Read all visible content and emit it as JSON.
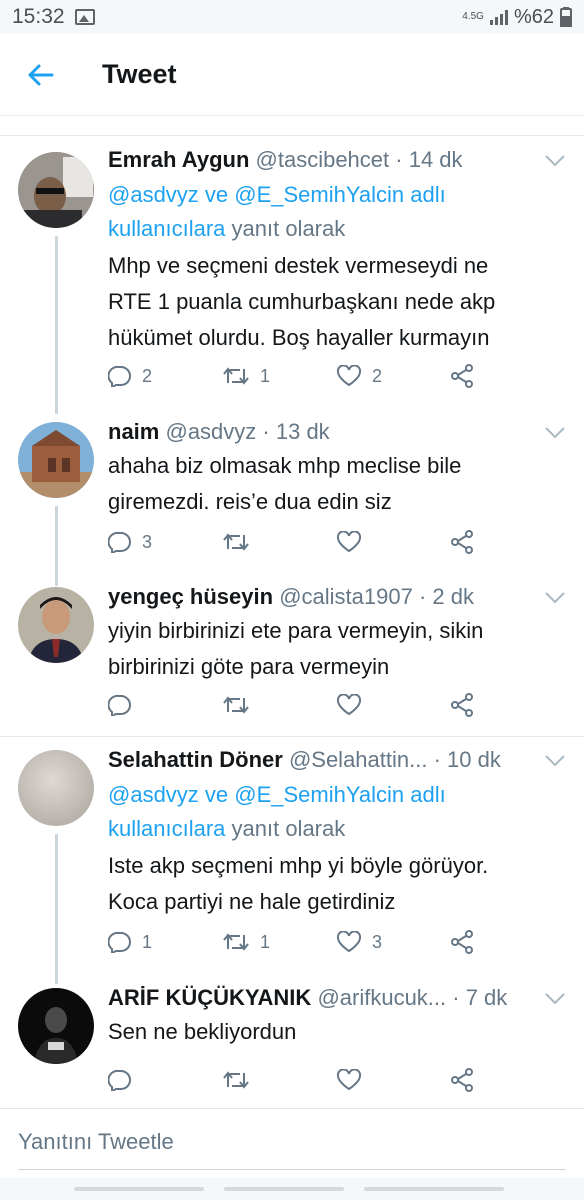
{
  "status_bar": {
    "time": "15:32",
    "network": "4.5G",
    "battery": "%62"
  },
  "header": {
    "title": "Tweet"
  },
  "reply_prefix": {
    "mentions": "@asdvyz ve @E_SemihYalcin adlı kullanıcılara",
    "suffix": "yanıt olarak"
  },
  "tweets": [
    {
      "name": "Emrah Aygun",
      "handle": "@tascibehcet",
      "age": "14 dk",
      "text_lines": [
        "Mhp ve seçmeni destek vermeseydi ne",
        "RTE 1 puanla cumhurbaşkanı nede akp",
        "hükümet olurdu. Boş hayaller kurmayın"
      ],
      "replies": "2",
      "retweets": "1",
      "likes": "2"
    },
    {
      "name": "naim",
      "handle": "@asdvyz",
      "age": "13 dk",
      "text_lines": [
        "ahaha biz olmasak mhp meclise bile",
        "giremezdi. reis’e dua edin siz"
      ],
      "replies": "3",
      "retweets": "",
      "likes": ""
    },
    {
      "name": "yengeç hüseyin",
      "handle": "@calista1907",
      "age": "2 dk",
      "text_lines": [
        "yiyin birbirinizi ete para vermeyin, sikin",
        "birbirinizi göte para vermeyin"
      ],
      "replies": "",
      "retweets": "",
      "likes": ""
    },
    {
      "name": "Selahattin Döner",
      "handle": "@Selahattin...",
      "age": "10 dk",
      "text_lines": [
        "Iste akp seçmeni mhp yi böyle görüyor.",
        "Koca partiyi ne hale getirdiniz"
      ],
      "replies": "1",
      "retweets": "1",
      "likes": "3"
    },
    {
      "name": "ARİF KÜÇÜKYANIK",
      "handle": "@arifkucuk...",
      "age": "7 dk",
      "text_lines": [
        "Sen ne bekliyordun"
      ],
      "replies": "",
      "retweets": "",
      "likes": ""
    }
  ],
  "composer": {
    "placeholder": "Yanıtını Tweetle"
  },
  "colors": {
    "accent": "#1da1f2",
    "secondary_text": "#657786",
    "divider": "#e1e8ed"
  }
}
